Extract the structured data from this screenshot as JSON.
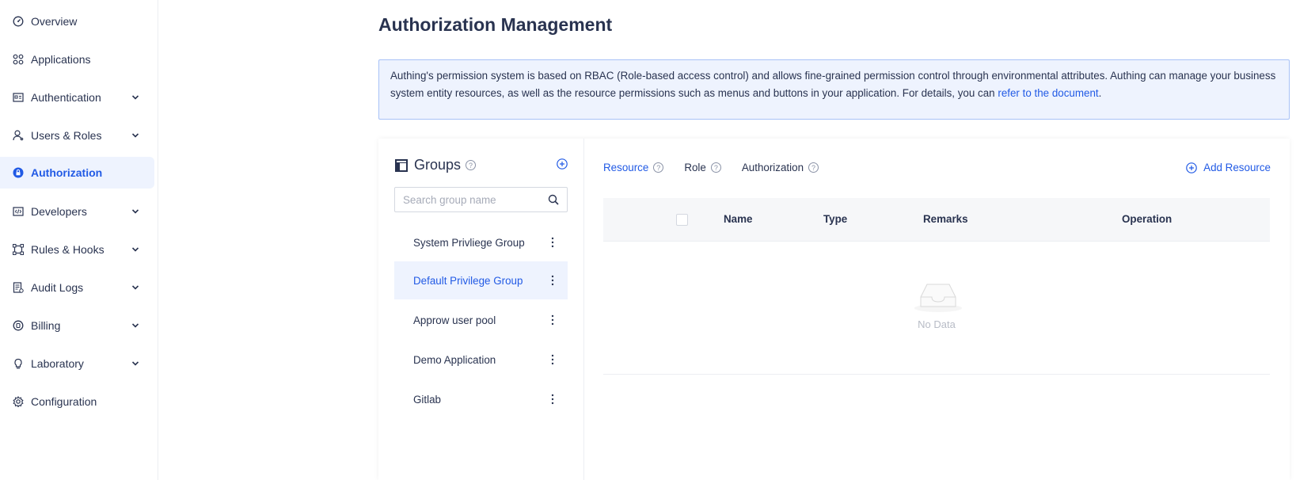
{
  "sidebar": {
    "items": [
      {
        "label": "Overview",
        "icon": "dashboard-icon",
        "expandable": false
      },
      {
        "label": "Applications",
        "icon": "apps-grid-icon",
        "expandable": false
      },
      {
        "label": "Authentication",
        "icon": "id-card-icon",
        "expandable": true
      },
      {
        "label": "Users & Roles",
        "icon": "user-icon",
        "expandable": true
      },
      {
        "label": "Authorization",
        "icon": "lock-circle-icon",
        "expandable": false,
        "active": true
      },
      {
        "label": "Developers",
        "icon": "code-icon",
        "expandable": true
      },
      {
        "label": "Rules & Hooks",
        "icon": "nodes-icon",
        "expandable": true
      },
      {
        "label": "Audit Logs",
        "icon": "log-icon",
        "expandable": true
      },
      {
        "label": "Billing",
        "icon": "coin-icon",
        "expandable": true
      },
      {
        "label": "Laboratory",
        "icon": "bulb-icon",
        "expandable": true
      },
      {
        "label": "Configuration",
        "icon": "gear-icon",
        "expandable": false
      }
    ]
  },
  "page": {
    "title": "Authorization Management",
    "info_text": "Authing's permission system is based on RBAC (Role-based access control) and allows fine-grained permission control through environmental attributes. Authing can manage your business system entity resources, as well as the resource permissions such as menus and buttons in your application. For details, you can ",
    "info_link": "refer to the document",
    "info_end": "."
  },
  "groups": {
    "title": "Groups",
    "search_placeholder": "Search group name",
    "items": [
      {
        "label": "System Privliege Group"
      },
      {
        "label": "Default Privilege Group",
        "active": true
      },
      {
        "label": "Approw user pool"
      },
      {
        "label": "Demo Application"
      },
      {
        "label": "Gitlab"
      }
    ]
  },
  "tabs": {
    "resource": "Resource",
    "role": "Role",
    "authorization": "Authorization",
    "add_resource": "Add Resource"
  },
  "table": {
    "columns": [
      "Name",
      "Type",
      "Remarks",
      "Operation"
    ],
    "rows": [],
    "empty_text": "No Data"
  },
  "colors": {
    "accent": "#215ae5",
    "active_bg": "#eef3fe",
    "text": "#293350"
  }
}
